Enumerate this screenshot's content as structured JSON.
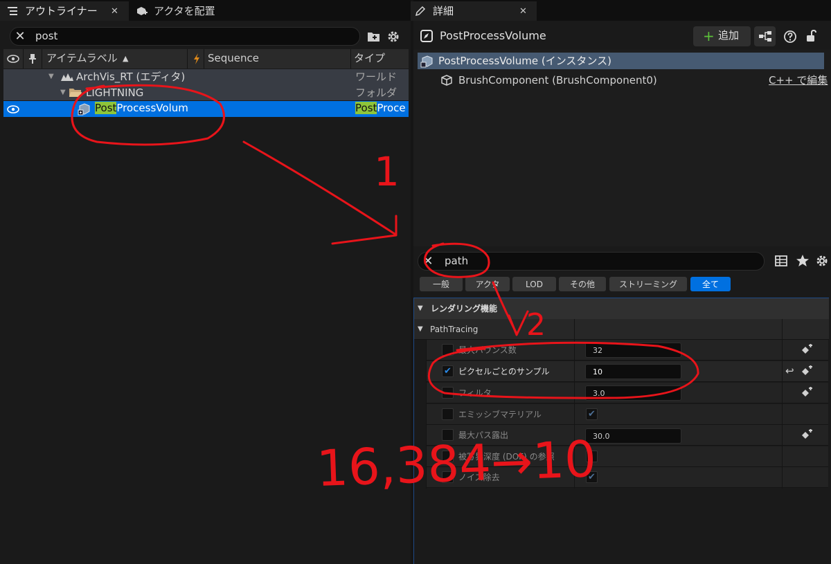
{
  "outliner": {
    "tab_title": "アウトライナー",
    "tab_close": "✕",
    "place_actors_tab": "アクタを配置",
    "search_value": "post",
    "search_clear": "✕",
    "columns": {
      "label": "アイテムラベル",
      "sort_arrow": "▲",
      "sequence": "Sequence",
      "type": "タイプ"
    },
    "rows": [
      {
        "label": "ArchVis_RT (エディタ)",
        "type": "ワールド"
      },
      {
        "label": "LIGHTNING",
        "type": "フォルダ"
      },
      {
        "label_match": "Post",
        "label_rest": "ProcessVolum",
        "type_match": "Post",
        "type_rest": "Proce"
      }
    ]
  },
  "details": {
    "tab_title": "詳細",
    "tab_close": "✕",
    "actor_name": "PostProcessVolume",
    "add_button": "追加",
    "add_plus": "+",
    "components": [
      {
        "label": "PostProcessVolume (インスタンス)"
      },
      {
        "label": "BrushComponent (BrushComponent0)",
        "action": "C++ で編集"
      }
    ],
    "search_value": "path",
    "search_clear": "✕",
    "filters": [
      "一般",
      "アクタ",
      "LOD",
      "その他",
      "ストリーミング",
      "全て"
    ],
    "category": "レンダリング機能",
    "subcategory": "PathTracing",
    "properties": [
      {
        "label": "最大バウンス数",
        "value": "32",
        "checked": false
      },
      {
        "label": "ピクセルごとのサンプル",
        "value": "10",
        "checked": true
      },
      {
        "label": "フィルタ",
        "value": "3.0",
        "checked": false
      },
      {
        "label": "エミッシブマテリアル",
        "checked": false,
        "value_check": "✔"
      },
      {
        "label": "最大パス露出",
        "value": "30.0",
        "checked": false
      },
      {
        "label": "被写界深度 (DOF) の参照",
        "checked": false
      },
      {
        "label": "ノイズ除去",
        "checked": false,
        "value_check": "✔"
      }
    ],
    "checkmark": "✔",
    "reset_icon": "↩"
  },
  "annotations": {
    "step1": "1",
    "step2": "2",
    "note": "16,384→10"
  },
  "colors": {
    "selection": "#0070e0",
    "highlight": "#8ec53a",
    "annotation_red": "#e8141a",
    "component_selected": "#465a72"
  }
}
